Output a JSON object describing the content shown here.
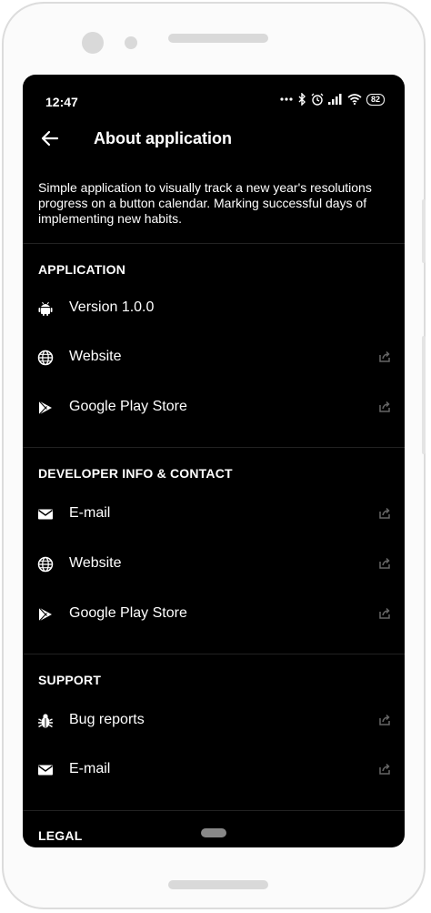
{
  "status_bar": {
    "time": "12:47",
    "battery": "82"
  },
  "app_bar": {
    "title": "About application"
  },
  "description": "Simple application to visually track a new year's resolutions progress on a button calendar. Marking successful days of implementing new habits.",
  "sections": [
    {
      "title": "APPLICATION",
      "items": [
        {
          "label": "Version 1.0.0",
          "icon": "android-icon",
          "external": false
        },
        {
          "label": "Website",
          "icon": "globe-icon",
          "external": true
        },
        {
          "label": "Google Play Store",
          "icon": "play-store-icon",
          "external": true
        }
      ]
    },
    {
      "title": "DEVELOPER INFO & CONTACT",
      "items": [
        {
          "label": "E-mail",
          "icon": "mail-icon",
          "external": true
        },
        {
          "label": "Website",
          "icon": "globe-icon",
          "external": true
        },
        {
          "label": "Google Play Store",
          "icon": "play-store-icon",
          "external": true
        }
      ]
    },
    {
      "title": "SUPPORT",
      "items": [
        {
          "label": "Bug reports",
          "icon": "bug-icon",
          "external": true
        },
        {
          "label": "E-mail",
          "icon": "mail-icon",
          "external": true
        }
      ]
    },
    {
      "title": "LEGAL",
      "items": []
    }
  ],
  "colors": {
    "background": "#000000",
    "text": "#ffffff",
    "divider": "#222222",
    "frame": "#dcdcdc"
  }
}
